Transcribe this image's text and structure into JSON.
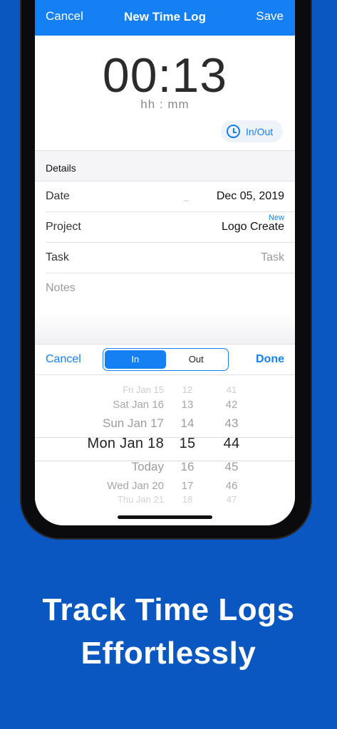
{
  "navbar": {
    "cancel": "Cancel",
    "title": "New Time Log",
    "save": "Save"
  },
  "timer": {
    "display": "00:13",
    "units": "hh : mm"
  },
  "inout_button": {
    "label": "In/Out",
    "icon": "clock-icon"
  },
  "details": {
    "header": "Details",
    "date": {
      "label": "Date",
      "value": "Dec 05, 2019",
      "dash": "_"
    },
    "project": {
      "label": "Project",
      "value": "Logo Create",
      "badge": "New"
    },
    "task": {
      "label": "Task",
      "placeholder": "Task"
    },
    "notes": {
      "placeholder": "Notes"
    }
  },
  "picker_toolbar": {
    "cancel": "Cancel",
    "done": "Done",
    "segments": [
      {
        "label": "In",
        "active": true
      },
      {
        "label": "Out",
        "active": false
      }
    ]
  },
  "picker": {
    "dates": [
      "Fri Jan 15",
      "Sat Jan 16",
      "Sun Jan 17",
      "Mon Jan 18",
      "Today",
      "Wed Jan 20",
      "Thu Jan 21"
    ],
    "hours": [
      "12",
      "13",
      "14",
      "15",
      "16",
      "17",
      "18"
    ],
    "minutes": [
      "41",
      "42",
      "43",
      "44",
      "45",
      "46",
      "47"
    ],
    "selected_index": 3
  },
  "headline": {
    "line1": "Track Time Logs",
    "line2": "Effortlessly"
  },
  "colors": {
    "background": "#0a57c2",
    "accent": "#1480f4"
  }
}
